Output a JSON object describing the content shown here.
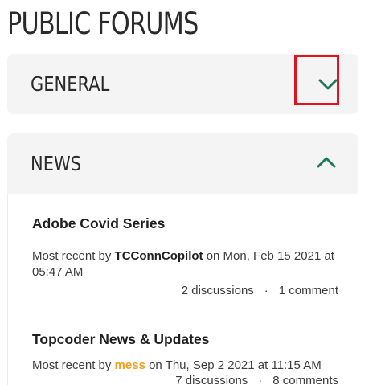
{
  "page": {
    "title": "PUBLIC FORUMS"
  },
  "colors": {
    "accent_green": "#1f7a5a",
    "highlight_red": "#e0141e",
    "user_orange": "#f0a020"
  },
  "categories": [
    {
      "label": "GENERAL",
      "expanded": false,
      "toggle_icon": "chevron-down-icon"
    },
    {
      "label": "NEWS",
      "expanded": true,
      "toggle_icon": "chevron-up-icon",
      "forums": [
        {
          "title": "Adobe Covid Series",
          "recent_prefix": "Most recent by",
          "recent_user": "TCConnCopilot",
          "recent_suffix": "on Mon, Feb 15 2021 at 05:47 AM",
          "discussions": "2 discussions",
          "separator": "·",
          "comments": "1 comment"
        },
        {
          "title": "Topcoder News & Updates",
          "recent_prefix": "Most recent by",
          "recent_user": "mess",
          "recent_suffix": "on Thu, Sep 2 2021 at 11:15 AM",
          "discussions": "7 discussions",
          "separator": "·",
          "comments": "8 comments"
        }
      ]
    }
  ]
}
